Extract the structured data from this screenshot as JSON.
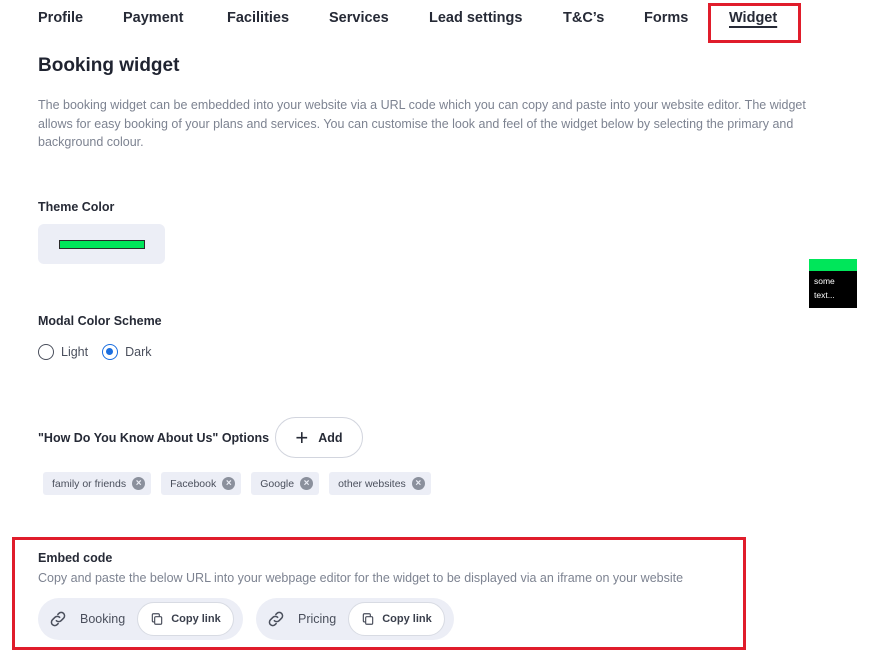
{
  "tabs": [
    {
      "label": "Profile"
    },
    {
      "label": "Payment"
    },
    {
      "label": "Facilities"
    },
    {
      "label": "Services"
    },
    {
      "label": "Lead settings"
    },
    {
      "label": "T&C’s"
    },
    {
      "label": "Forms"
    },
    {
      "label": "Widget"
    }
  ],
  "active_tab": "Widget",
  "page": {
    "title": "Booking widget",
    "description": "The booking widget can be embedded into your website via a URL code which you can copy and paste into your website editor. The widget allows for easy booking of your plans and services. You can customise the look and feel of the widget below by selecting the primary and background colour."
  },
  "theme": {
    "label": "Theme Color",
    "color": "#00E65A"
  },
  "modal_scheme": {
    "label": "Modal Color Scheme",
    "options": [
      {
        "label": "Light",
        "checked": false
      },
      {
        "label": "Dark",
        "checked": true
      }
    ]
  },
  "how_know": {
    "label": "\"How Do You Know About Us\" Options",
    "add_label": "Add",
    "options": [
      {
        "label": "family or friends"
      },
      {
        "label": "Facebook"
      },
      {
        "label": "Google"
      },
      {
        "label": "other websites"
      }
    ]
  },
  "preview": {
    "text_line1": "some",
    "text_line2": "text..."
  },
  "embed": {
    "label": "Embed code",
    "description": "Copy and paste the below URL into your webpage editor for the widget to be displayed via an iframe on your website",
    "cards": [
      {
        "label": "Booking",
        "copy_label": "Copy link"
      },
      {
        "label": "Pricing",
        "copy_label": "Copy link"
      }
    ]
  },
  "colors": {
    "highlight": "#E01D2B",
    "accent": "#1A6EE0",
    "chip_bg": "#ECEEF6"
  }
}
